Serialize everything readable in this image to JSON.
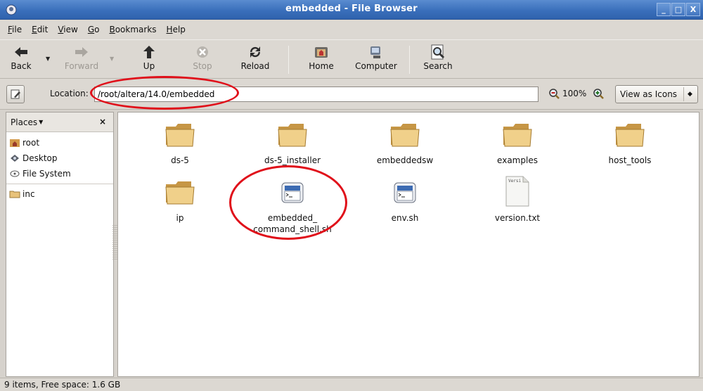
{
  "window": {
    "title": "embedded - File Browser"
  },
  "menu": [
    "File",
    "Edit",
    "View",
    "Go",
    "Bookmarks",
    "Help"
  ],
  "menu_mnemonics": [
    "F",
    "E",
    "V",
    "G",
    "B",
    "H"
  ],
  "toolbar": {
    "back": "Back",
    "forward": "Forward",
    "up": "Up",
    "stop": "Stop",
    "reload": "Reload",
    "home": "Home",
    "computer": "Computer",
    "search": "Search"
  },
  "location": {
    "label": "Location:",
    "value": "/root/altera/14.0/embedded",
    "zoom": "100%",
    "view_mode": "View as Icons"
  },
  "sidebar": {
    "title": "Places",
    "items": [
      {
        "label": "root",
        "icon": "home-folder-icon"
      },
      {
        "label": "Desktop",
        "icon": "desktop-icon"
      },
      {
        "label": "File System",
        "icon": "drive-icon"
      },
      {
        "label": "inc",
        "icon": "folder-icon"
      }
    ]
  },
  "files": [
    {
      "name": "ds-5",
      "type": "folder"
    },
    {
      "name": "ds-5_installer",
      "type": "folder"
    },
    {
      "name": "embeddedsw",
      "type": "folder"
    },
    {
      "name": "examples",
      "type": "folder"
    },
    {
      "name": "host_tools",
      "type": "folder"
    },
    {
      "name": "ip",
      "type": "folder"
    },
    {
      "name": "embedded_\ncommand_shell.sh",
      "type": "script"
    },
    {
      "name": "env.sh",
      "type": "script"
    },
    {
      "name": "version.txt",
      "type": "text",
      "preview": "Versi"
    }
  ],
  "status": "9 items, Free space: 1.6 GB",
  "annotation_color": "#e0101a"
}
